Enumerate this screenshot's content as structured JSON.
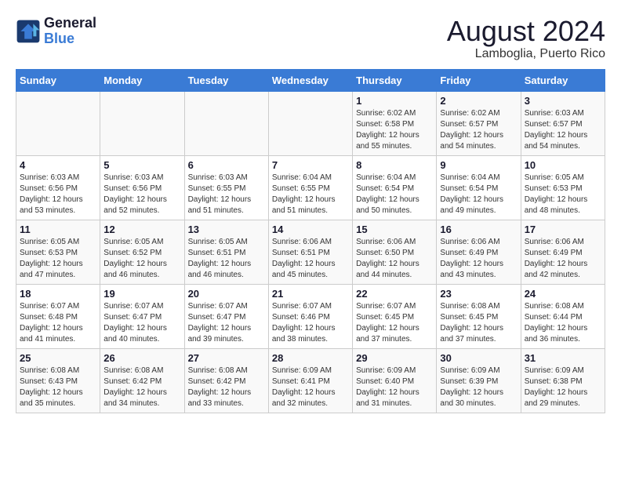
{
  "header": {
    "logo_line1": "General",
    "logo_line2": "Blue",
    "title": "August 2024",
    "subtitle": "Lamboglia, Puerto Rico"
  },
  "days_of_week": [
    "Sunday",
    "Monday",
    "Tuesday",
    "Wednesday",
    "Thursday",
    "Friday",
    "Saturday"
  ],
  "weeks": [
    [
      {
        "day": "",
        "info": ""
      },
      {
        "day": "",
        "info": ""
      },
      {
        "day": "",
        "info": ""
      },
      {
        "day": "",
        "info": ""
      },
      {
        "day": "1",
        "info": "Sunrise: 6:02 AM\nSunset: 6:58 PM\nDaylight: 12 hours\nand 55 minutes."
      },
      {
        "day": "2",
        "info": "Sunrise: 6:02 AM\nSunset: 6:57 PM\nDaylight: 12 hours\nand 54 minutes."
      },
      {
        "day": "3",
        "info": "Sunrise: 6:03 AM\nSunset: 6:57 PM\nDaylight: 12 hours\nand 54 minutes."
      }
    ],
    [
      {
        "day": "4",
        "info": "Sunrise: 6:03 AM\nSunset: 6:56 PM\nDaylight: 12 hours\nand 53 minutes."
      },
      {
        "day": "5",
        "info": "Sunrise: 6:03 AM\nSunset: 6:56 PM\nDaylight: 12 hours\nand 52 minutes."
      },
      {
        "day": "6",
        "info": "Sunrise: 6:03 AM\nSunset: 6:55 PM\nDaylight: 12 hours\nand 51 minutes."
      },
      {
        "day": "7",
        "info": "Sunrise: 6:04 AM\nSunset: 6:55 PM\nDaylight: 12 hours\nand 51 minutes."
      },
      {
        "day": "8",
        "info": "Sunrise: 6:04 AM\nSunset: 6:54 PM\nDaylight: 12 hours\nand 50 minutes."
      },
      {
        "day": "9",
        "info": "Sunrise: 6:04 AM\nSunset: 6:54 PM\nDaylight: 12 hours\nand 49 minutes."
      },
      {
        "day": "10",
        "info": "Sunrise: 6:05 AM\nSunset: 6:53 PM\nDaylight: 12 hours\nand 48 minutes."
      }
    ],
    [
      {
        "day": "11",
        "info": "Sunrise: 6:05 AM\nSunset: 6:53 PM\nDaylight: 12 hours\nand 47 minutes."
      },
      {
        "day": "12",
        "info": "Sunrise: 6:05 AM\nSunset: 6:52 PM\nDaylight: 12 hours\nand 46 minutes."
      },
      {
        "day": "13",
        "info": "Sunrise: 6:05 AM\nSunset: 6:51 PM\nDaylight: 12 hours\nand 46 minutes."
      },
      {
        "day": "14",
        "info": "Sunrise: 6:06 AM\nSunset: 6:51 PM\nDaylight: 12 hours\nand 45 minutes."
      },
      {
        "day": "15",
        "info": "Sunrise: 6:06 AM\nSunset: 6:50 PM\nDaylight: 12 hours\nand 44 minutes."
      },
      {
        "day": "16",
        "info": "Sunrise: 6:06 AM\nSunset: 6:49 PM\nDaylight: 12 hours\nand 43 minutes."
      },
      {
        "day": "17",
        "info": "Sunrise: 6:06 AM\nSunset: 6:49 PM\nDaylight: 12 hours\nand 42 minutes."
      }
    ],
    [
      {
        "day": "18",
        "info": "Sunrise: 6:07 AM\nSunset: 6:48 PM\nDaylight: 12 hours\nand 41 minutes."
      },
      {
        "day": "19",
        "info": "Sunrise: 6:07 AM\nSunset: 6:47 PM\nDaylight: 12 hours\nand 40 minutes."
      },
      {
        "day": "20",
        "info": "Sunrise: 6:07 AM\nSunset: 6:47 PM\nDaylight: 12 hours\nand 39 minutes."
      },
      {
        "day": "21",
        "info": "Sunrise: 6:07 AM\nSunset: 6:46 PM\nDaylight: 12 hours\nand 38 minutes."
      },
      {
        "day": "22",
        "info": "Sunrise: 6:07 AM\nSunset: 6:45 PM\nDaylight: 12 hours\nand 37 minutes."
      },
      {
        "day": "23",
        "info": "Sunrise: 6:08 AM\nSunset: 6:45 PM\nDaylight: 12 hours\nand 37 minutes."
      },
      {
        "day": "24",
        "info": "Sunrise: 6:08 AM\nSunset: 6:44 PM\nDaylight: 12 hours\nand 36 minutes."
      }
    ],
    [
      {
        "day": "25",
        "info": "Sunrise: 6:08 AM\nSunset: 6:43 PM\nDaylight: 12 hours\nand 35 minutes."
      },
      {
        "day": "26",
        "info": "Sunrise: 6:08 AM\nSunset: 6:42 PM\nDaylight: 12 hours\nand 34 minutes."
      },
      {
        "day": "27",
        "info": "Sunrise: 6:08 AM\nSunset: 6:42 PM\nDaylight: 12 hours\nand 33 minutes."
      },
      {
        "day": "28",
        "info": "Sunrise: 6:09 AM\nSunset: 6:41 PM\nDaylight: 12 hours\nand 32 minutes."
      },
      {
        "day": "29",
        "info": "Sunrise: 6:09 AM\nSunset: 6:40 PM\nDaylight: 12 hours\nand 31 minutes."
      },
      {
        "day": "30",
        "info": "Sunrise: 6:09 AM\nSunset: 6:39 PM\nDaylight: 12 hours\nand 30 minutes."
      },
      {
        "day": "31",
        "info": "Sunrise: 6:09 AM\nSunset: 6:38 PM\nDaylight: 12 hours\nand 29 minutes."
      }
    ]
  ]
}
